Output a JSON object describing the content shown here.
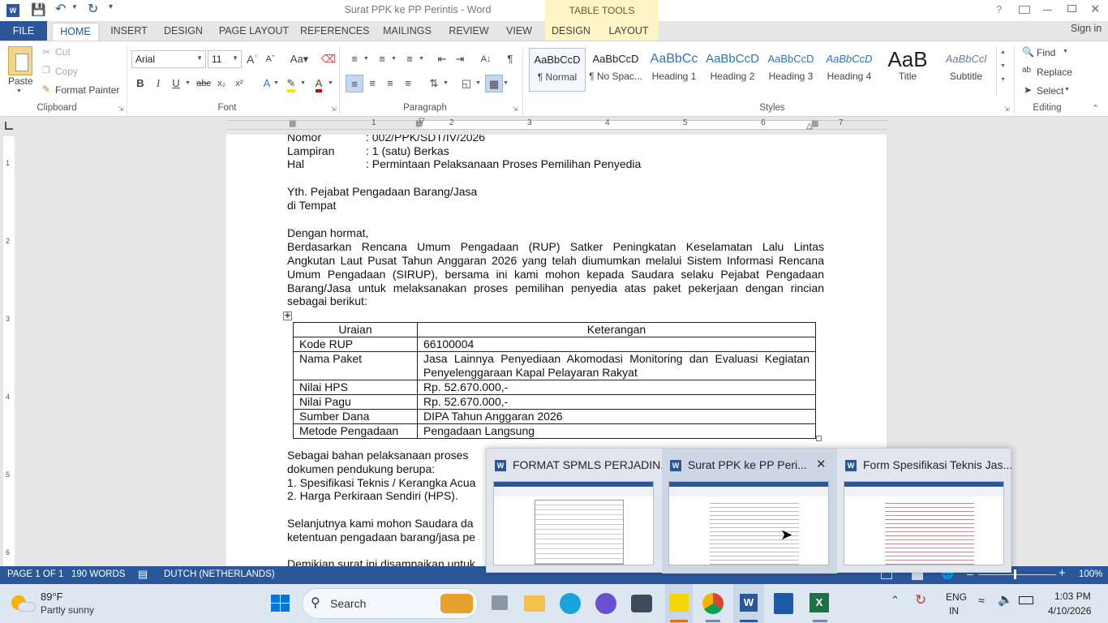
{
  "window": {
    "title": "Surat PPK ke PP Perintis - Word",
    "help": "?",
    "signin": "Sign in",
    "table_tools": "TABLE TOOLS"
  },
  "tabs": [
    "FILE",
    "HOME",
    "INSERT",
    "DESIGN",
    "PAGE LAYOUT",
    "REFERENCES",
    "MAILINGS",
    "REVIEW",
    "VIEW",
    "DESIGN",
    "LAYOUT"
  ],
  "clipboard": {
    "paste": "Paste",
    "cut": "Cut",
    "copy": "Copy",
    "format_painter": "Format Painter",
    "label": "Clipboard"
  },
  "font": {
    "name": "Arial",
    "size": "11",
    "label": "Font"
  },
  "paragraph": {
    "label": "Paragraph"
  },
  "styles": {
    "items": [
      {
        "preview": "AaBbCcD",
        "name": "¶ Normal"
      },
      {
        "preview": "AaBbCcD",
        "name": "¶ No Spac..."
      },
      {
        "preview": "AaBbCc",
        "name": "Heading 1"
      },
      {
        "preview": "AaBbCcD",
        "name": "Heading 2"
      },
      {
        "preview": "AaBbCcD",
        "name": "Heading 3"
      },
      {
        "preview": "AaBbCcD",
        "name": "Heading 4"
      },
      {
        "preview": "AaB",
        "name": "Title"
      },
      {
        "preview": "AaBbCcl",
        "name": "Subtitle"
      }
    ],
    "label": "Styles"
  },
  "editing": {
    "find": "Find",
    "replace": "Replace",
    "select": "Select",
    "label": "Editing"
  },
  "ruler": {
    "numbers": [
      "1",
      "2",
      "3",
      "4",
      "5",
      "6",
      "7"
    ],
    "vnumbers": [
      "1",
      "2",
      "3",
      "4",
      "5",
      "6"
    ]
  },
  "doc": {
    "nomor_label": "Nomor",
    "nomor_value": ": 002/PPK/SDT/IV/2026",
    "lampiran_label": "Lampiran",
    "lampiran_value": ": 1 (satu) Berkas",
    "hal_label": "Hal",
    "hal_value": ": Permintaan Pelaksanaan Proses Pemilihan Penyedia",
    "yth": "Yth. Pejabat Pengadaan Barang/Jasa",
    "tempat": "di Tempat",
    "salam": "Dengan hormat,",
    "p1": [
      "Berdasarkan Rencana Umum Pengadaan (RUP) Satker Peningkatan Keselamatan Lalu Lintas",
      "Angkutan Laut Pusat Tahun Anggaran 2026 yang telah diumumkan melalui Sistem Informasi Rencana",
      "Umum Pengadaan (SIRUP), bersama ini kami mohon kepada Saudara selaku Pejabat Pengadaan",
      "Barang/Jasa untuk melaksanakan proses pemilihan penyedia atas paket pekerjaan dengan rincian",
      "sebagai berikut:"
    ],
    "table_head": [
      "Uraian",
      "Keterangan"
    ],
    "table_rows": [
      [
        "Kode RUP",
        "66100004"
      ],
      [
        "Nama Paket",
        "Jasa Lainnya Penyediaan Akomodasi Monitoring dan Evaluasi Kegiatan Penyelenggaraan Kapal Pelayaran Rakyat"
      ],
      [
        "Nilai HPS",
        "Rp. 52.670.000,-"
      ],
      [
        "Nilai Pagu",
        "Rp. 52.670.000,-"
      ],
      [
        "Sumber Dana",
        "DIPA Tahun Anggaran 2026"
      ],
      [
        "Metode Pengadaan",
        "Pengadaan Langsung"
      ]
    ],
    "p2a": "Sebagai bahan pelaksanaan proses",
    "p2b": "dokumen pendukung berupa:",
    "li1": "1.  Spesifikasi Teknis / Kerangka Acua",
    "li2": "2.  Harga Perkiraan Sendiri (HPS).",
    "p3a": "Selanjutnya kami mohon Saudara da",
    "p3b": "ketentuan pengadaan barang/jasa pe",
    "p4": "Demikian surat ini disampaikan untuk"
  },
  "status": {
    "page": "PAGE 1 OF 1",
    "words": "190 WORDS",
    "language": "DUTCH (NETHERLANDS)",
    "zoom": "100%"
  },
  "thumbnails": [
    {
      "title": "FORMAT SPMLS PERJADIN..."
    },
    {
      "title": "Surat PPK ke PP Peri..."
    },
    {
      "title": "Form Spesifikasi Teknis Jas..."
    }
  ],
  "taskbar": {
    "weather_temp": "89°F",
    "weather_desc": "Partly sunny",
    "search": "Search",
    "lang1": "ENG",
    "lang2": "IN",
    "time": "1:03 PM",
    "date": "4/10/2026"
  }
}
